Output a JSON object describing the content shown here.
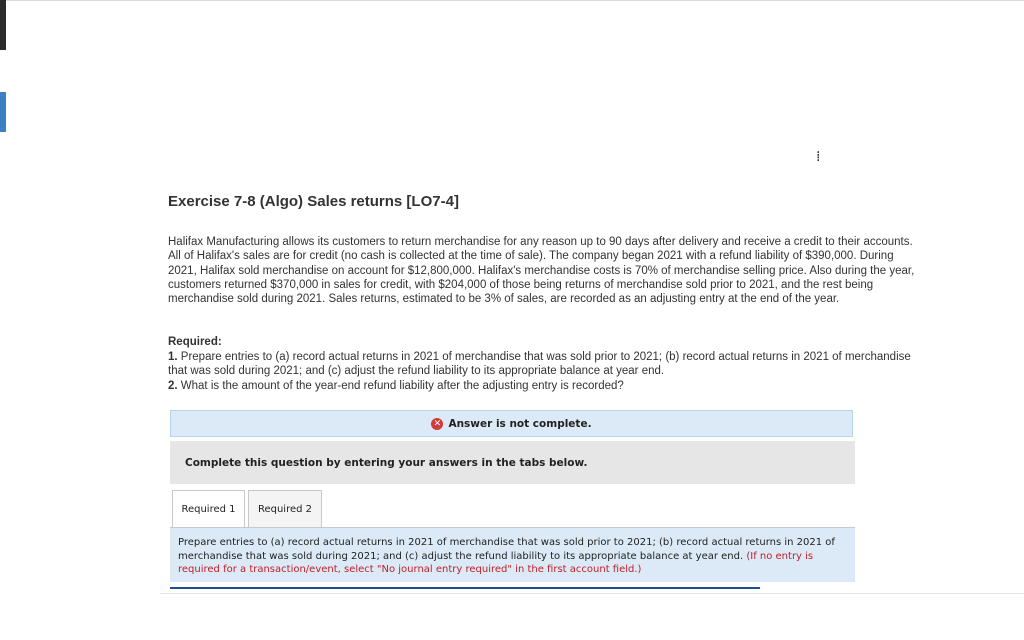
{
  "exercise": {
    "title": "Exercise 7-8 (Algo) Sales returns [LO7-4]",
    "problem_text": "Halifax Manufacturing allows its customers to return merchandise for any reason up to 90 days after delivery and receive a credit to their accounts. All of Halifax's sales are for credit (no cash is collected at the time of sale). The company began 2021 with a refund liability of $390,000. During 2021, Halifax sold merchandise on account for $12,800,000. Halifax's merchandise costs is 70% of merchandise selling price. Also during the year, customers returned $370,000 in sales for credit, with $204,000 of those being returns of merchandise sold prior to 2021, and the rest being merchandise sold during 2021. Sales returns, estimated to be 3% of sales, are recorded as an adjusting entry at the end of the year."
  },
  "required": {
    "heading": "Required:",
    "item1_number": "1.",
    "item1_text": " Prepare entries to (a) record actual returns in 2021 of merchandise that was sold prior to 2021; (b) record actual returns in 2021 of merchandise that was sold during 2021; and (c) adjust the refund liability to its appropriate balance at year end.",
    "item2_number": "2.",
    "item2_text": " What is the amount of the year-end refund liability after the adjusting entry is recorded?"
  },
  "status": {
    "icon": "x-circle-icon",
    "message": "Answer is not complete.",
    "color": "#d43a3a"
  },
  "instructions": "Complete this question by entering your answers in the tabs below.",
  "tabs": [
    {
      "label": "Required 1",
      "active": true
    },
    {
      "label": "Required 2",
      "active": false
    }
  ],
  "tab_panel": {
    "text": "Prepare entries to (a) record actual returns in 2021 of merchandise that was sold prior to 2021; (b) record actual returns in 2021 of merchandise that was sold during 2021; and (c) adjust the refund liability to its appropriate balance at year end. ",
    "hint": "(If no entry is required for a transaction/event, select \"No journal entry required\" in the first account field.)"
  },
  "colors": {
    "banner_bg": "#dbeaf6",
    "hint_text": "#c0202a",
    "accent_bar": "#1e4f8f"
  }
}
